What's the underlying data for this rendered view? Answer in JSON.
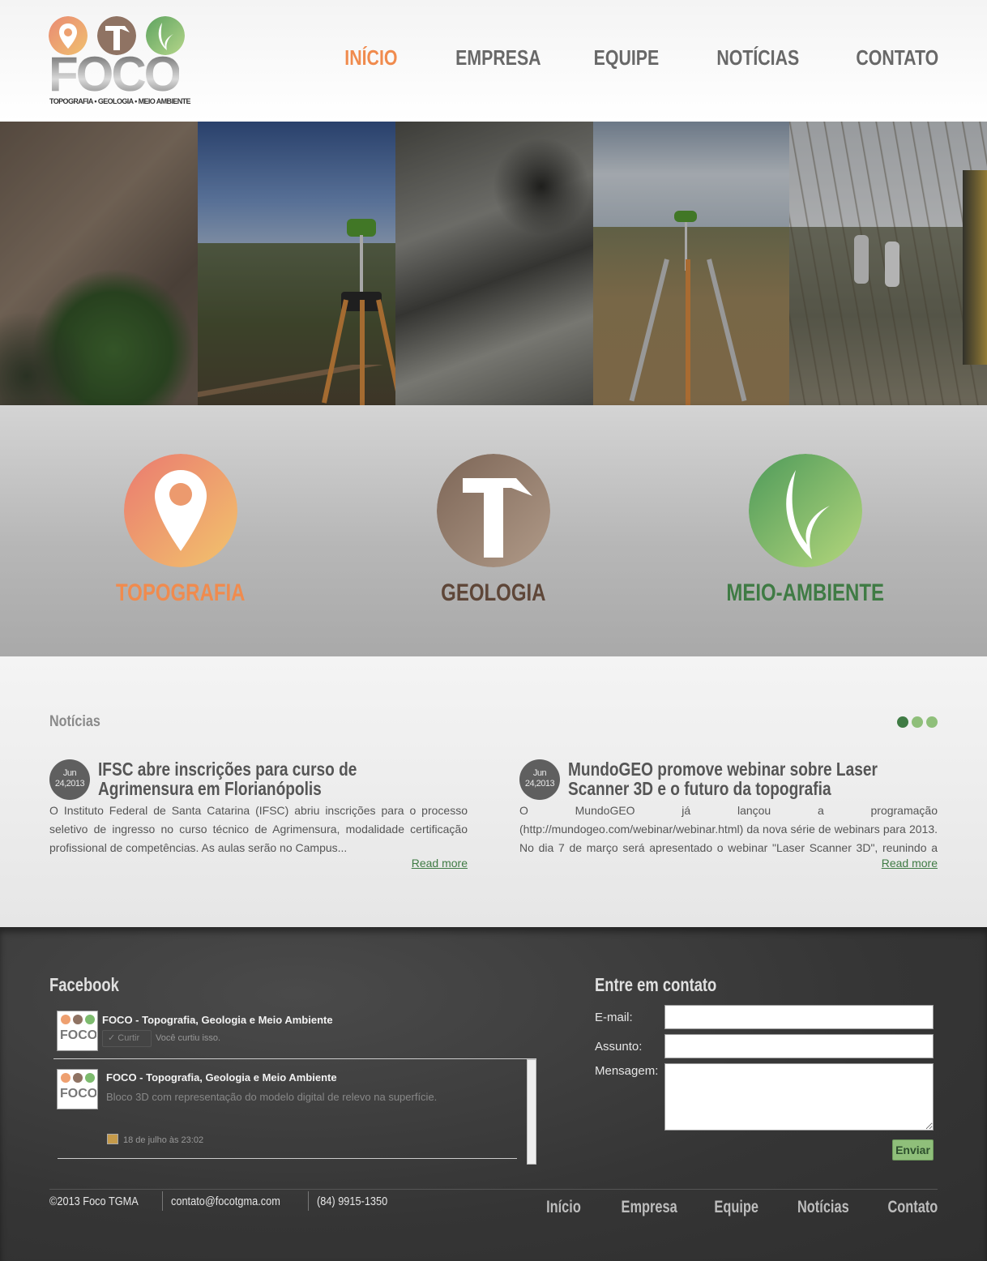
{
  "brand": {
    "name": "FOCO",
    "tagline": "TOPOGRAFIA • GEOLOGIA • MEIO AMBIENTE"
  },
  "nav": {
    "items": [
      {
        "label": "INÍCIO",
        "active": true
      },
      {
        "label": "EMPRESA",
        "active": false
      },
      {
        "label": "EQUIPE",
        "active": false
      },
      {
        "label": "NOTÍCIAS",
        "active": false
      },
      {
        "label": "CONTATO",
        "active": false
      }
    ]
  },
  "services": [
    {
      "label": "TOPOGRAFIA",
      "icon": "map-pin-icon",
      "color": "#f08b4e"
    },
    {
      "label": "GEOLOGIA",
      "icon": "hammer-icon",
      "color": "#5e4638"
    },
    {
      "label": "MEIO-AMBIENTE",
      "icon": "leaf-icon",
      "color": "#3f7b44"
    }
  ],
  "news": {
    "heading": "Notícias",
    "items": [
      {
        "date_month": "Jun",
        "date_day_year": "24,2013",
        "title": "IFSC abre inscrições para curso de Agrimensura em Florianópolis",
        "body": "O Instituto Federal de Santa Catarina (IFSC) abriu inscrições para o processo seletivo de ingresso no curso técnico de Agrimensura, modalidade certificação profissional de competências. As aulas serão no Campus...",
        "read_more": "Read more"
      },
      {
        "date_month": "Jun",
        "date_day_year": "24,2013",
        "title": "MundoGEO promove webinar sobre Laser Scanner 3D e o futuro da topografia",
        "body": "O MundoGEO já lançou a programação (http://mundogeo.com/webinar/webinar.html) da nova série de webinars para 2013. No dia 7 de março será apresentado o webinar \"Laser Scanner 3D\", reunindo a comunidade de...",
        "read_more": "Read more"
      }
    ]
  },
  "facebook": {
    "heading": "Facebook",
    "page_name": "FOCO - Topografia, Geologia e Meio Ambiente",
    "like_label": "✓ Curtir",
    "liked_text": "Você curtiu isso.",
    "post": {
      "author": "FOCO - Topografia, Geologia e Meio Ambiente",
      "text": "Bloco 3D com representação do modelo digital de relevo na superfície.",
      "date": "18 de julho às 23:02"
    }
  },
  "contact": {
    "heading": "Entre em contato",
    "email_label": "E-mail:",
    "subject_label": "Assunto:",
    "message_label": "Mensagem:",
    "email_value": "",
    "subject_value": "",
    "message_value": "",
    "send_label": "Enviar"
  },
  "footer": {
    "copyright": "©2013 Foco TGMA",
    "email": "contato@focotgma.com",
    "phone": "(84) 9915-1350",
    "nav": [
      "Início",
      "Empresa",
      "Equipe",
      "Notícias",
      "Contato"
    ]
  },
  "colors": {
    "accent_orange": "#f08b4e",
    "brown": "#5e4638",
    "green": "#3f7b44",
    "light_green": "#8fbf7a"
  }
}
